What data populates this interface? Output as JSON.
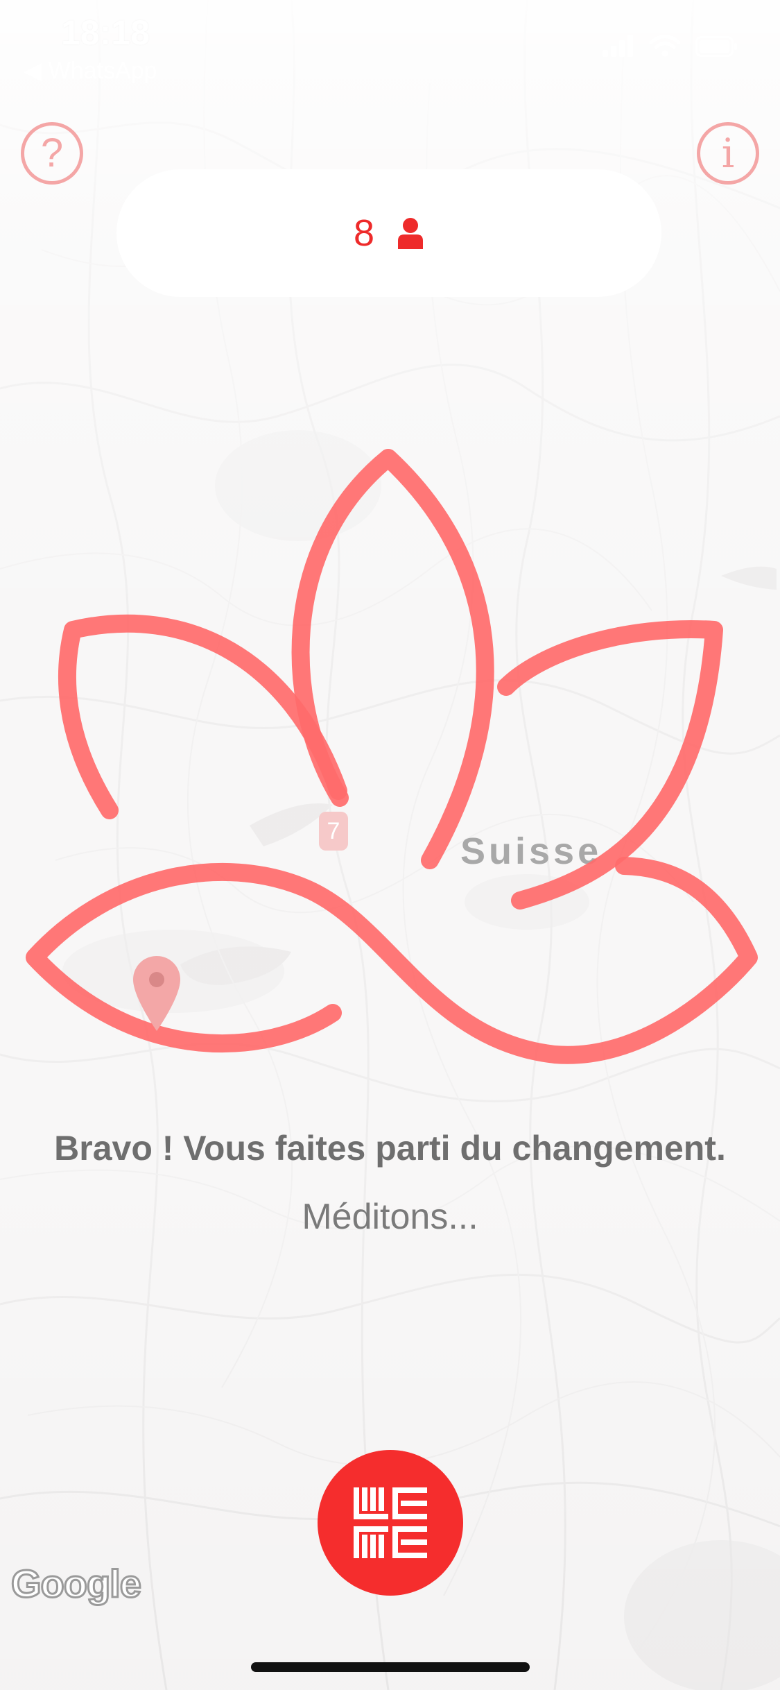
{
  "status_bar": {
    "time": "18:18",
    "back_app": "◀ WhatsApp"
  },
  "buttons": {
    "help_glyph": "?",
    "info_glyph": "i"
  },
  "counter": {
    "value": "8",
    "icon": "person-icon"
  },
  "map": {
    "region_label": "Suisse",
    "road_badge": "7",
    "attribution": "Google"
  },
  "message": {
    "headline": "Bravo ! Vous faites parti du changement.",
    "subline": "Méditons..."
  },
  "logo": {
    "icon": "weme-logo-icon"
  },
  "colors": {
    "accent": "#f52d2d",
    "lotus": "#ff6b6b",
    "help_ring": "#f4a6a6",
    "text": "#6e6e6e"
  }
}
